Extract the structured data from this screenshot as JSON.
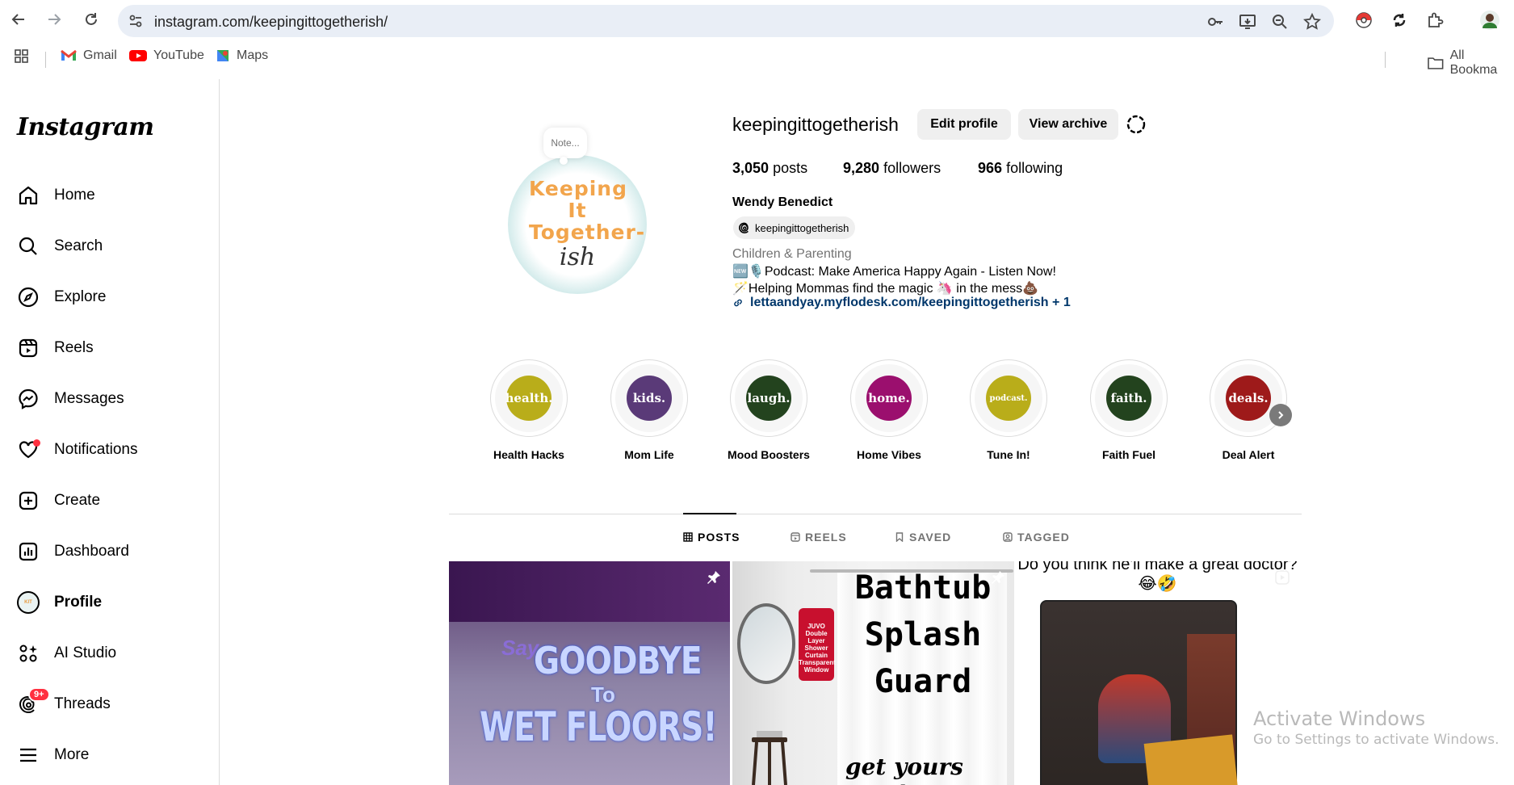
{
  "browser": {
    "url": "instagram.com/keepingittogetherish/",
    "bookmarks": [
      {
        "label": "Gmail"
      },
      {
        "label": "YouTube"
      },
      {
        "label": "Maps"
      }
    ],
    "all_bookmarks": "All Bookma"
  },
  "sidebar": {
    "logo": "Instagram",
    "items": [
      {
        "label": "Home"
      },
      {
        "label": "Search"
      },
      {
        "label": "Explore"
      },
      {
        "label": "Reels"
      },
      {
        "label": "Messages"
      },
      {
        "label": "Notifications"
      },
      {
        "label": "Create"
      },
      {
        "label": "Dashboard"
      },
      {
        "label": "Profile"
      },
      {
        "label": "AI Studio"
      },
      {
        "label": "Threads",
        "badge": "9+"
      },
      {
        "label": "More"
      }
    ]
  },
  "profile": {
    "note": "Note...",
    "avatar_text_top": "Keeping It Together-",
    "avatar_text_bottom": "ish",
    "username": "keepingittogetherish",
    "edit_profile": "Edit profile",
    "view_archive": "View archive",
    "posts_count": "3,050",
    "posts_label": "posts",
    "followers_count": "9,280",
    "followers_label": "followers",
    "following_count": "966",
    "following_label": "following",
    "full_name": "Wendy Benedict",
    "threads_handle": "keepingittogetherish",
    "category": "Children & Parenting",
    "bio_line1": "🆕🎙️Podcast: Make America Happy Again - Listen Now!",
    "bio_line2": "🪄Helping Mommas find the magic 🦄 in the mess💩",
    "link": "lettaandyay.myflodesk.com/keepingittogetherish + 1"
  },
  "highlights": [
    {
      "disc": "health.",
      "label": "Health Hacks",
      "color": "#b9ad1a"
    },
    {
      "disc": "kids.",
      "label": "Mom Life",
      "color": "#5a3a78"
    },
    {
      "disc": "laugh.",
      "label": "Mood Boosters",
      "color": "#23431e"
    },
    {
      "disc": "home.",
      "label": "Home Vibes",
      "color": "#9b0f6e"
    },
    {
      "disc": "podcast.",
      "label": "Tune In!",
      "color": "#b9ad1a"
    },
    {
      "disc": "faith.",
      "label": "Faith Fuel",
      "color": "#23431e"
    },
    {
      "disc": "deals.",
      "label": "Deal Alert",
      "color": "#9e1a1a"
    }
  ],
  "tabs": [
    {
      "label": "POSTS"
    },
    {
      "label": "REELS"
    },
    {
      "label": "SAVED"
    },
    {
      "label": "TAGGED"
    }
  ],
  "posts": {
    "p1": {
      "say": "Say",
      "goodbye": "GOODBYE",
      "to": "To",
      "wet": "WET FLOORS!"
    },
    "p2": {
      "line1": "Bathtub",
      "line2": "Splash",
      "line3": "Guard",
      "tag": "JUVO Double Layer Shower Curtain Transparent Window",
      "getyours": "get yours now!"
    },
    "p3": {
      "question": "Do you think he'll make a great doctor? 😂🤣"
    }
  },
  "watermark": {
    "line1": "Activate Windows",
    "line2": "Go to Settings to activate Windows."
  }
}
